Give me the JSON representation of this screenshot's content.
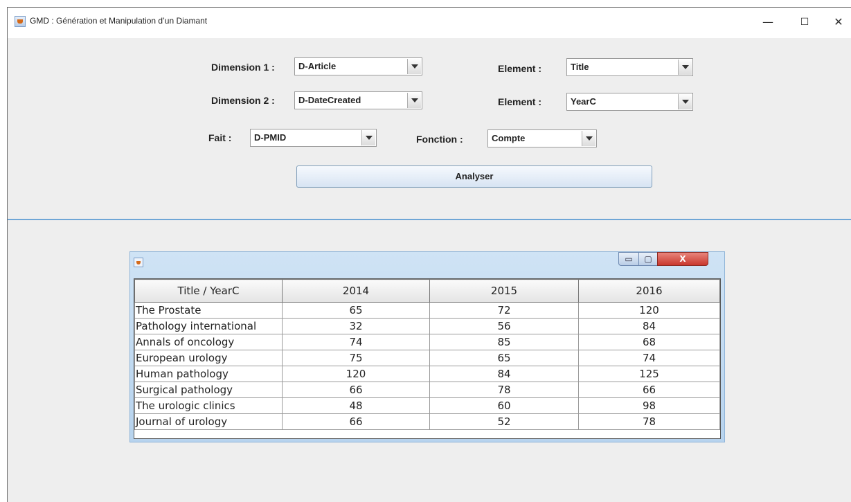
{
  "window": {
    "title": "GMD : Génération et Manipulation d’un Diamant",
    "controls": {
      "minimize": "—",
      "maximize": "☐",
      "close": "✕"
    }
  },
  "form": {
    "dimension1": {
      "label": "Dimension 1 :",
      "value": "D-Article"
    },
    "element1": {
      "label": "Element :",
      "value": "Title"
    },
    "dimension2": {
      "label": "Dimension 2 :",
      "value": "D-DateCreated"
    },
    "element2": {
      "label": "Element :",
      "value": "YearC"
    },
    "fait": {
      "label": "Fait :",
      "value": "D-PMID"
    },
    "fonction": {
      "label": "Fonction :",
      "value": "Compte"
    },
    "analyse_button": "Analyser"
  },
  "result_window": {
    "buttons": {
      "minimize": "▭",
      "maximize": "▢",
      "close": "X"
    },
    "table": {
      "headers": [
        "Title / YearC",
        "2014",
        "2015",
        "2016"
      ],
      "rows": [
        {
          "title": "The Prostate",
          "y2014": "65",
          "y2015": "72",
          "y2016": "120"
        },
        {
          "title": "Pathology international",
          "y2014": "32",
          "y2015": "56",
          "y2016": "84"
        },
        {
          "title": "Annals of oncology",
          "y2014": "74",
          "y2015": "85",
          "y2016": "68"
        },
        {
          "title": "European urology",
          "y2014": "75",
          "y2015": "65",
          "y2016": "74"
        },
        {
          "title": "Human pathology",
          "y2014": "120",
          "y2015": "84",
          "y2016": "125"
        },
        {
          "title": "Surgical pathology",
          "y2014": "66",
          "y2015": "78",
          "y2016": "66"
        },
        {
          "title": "The urologic clinics",
          "y2014": "48",
          "y2015": "60",
          "y2016": "98"
        },
        {
          "title": "Journal of urology",
          "y2014": "66",
          "y2015": "52",
          "y2016": "78"
        }
      ]
    }
  },
  "colors": {
    "divider": "#6fa6d6",
    "close_button": "#d9453b"
  }
}
